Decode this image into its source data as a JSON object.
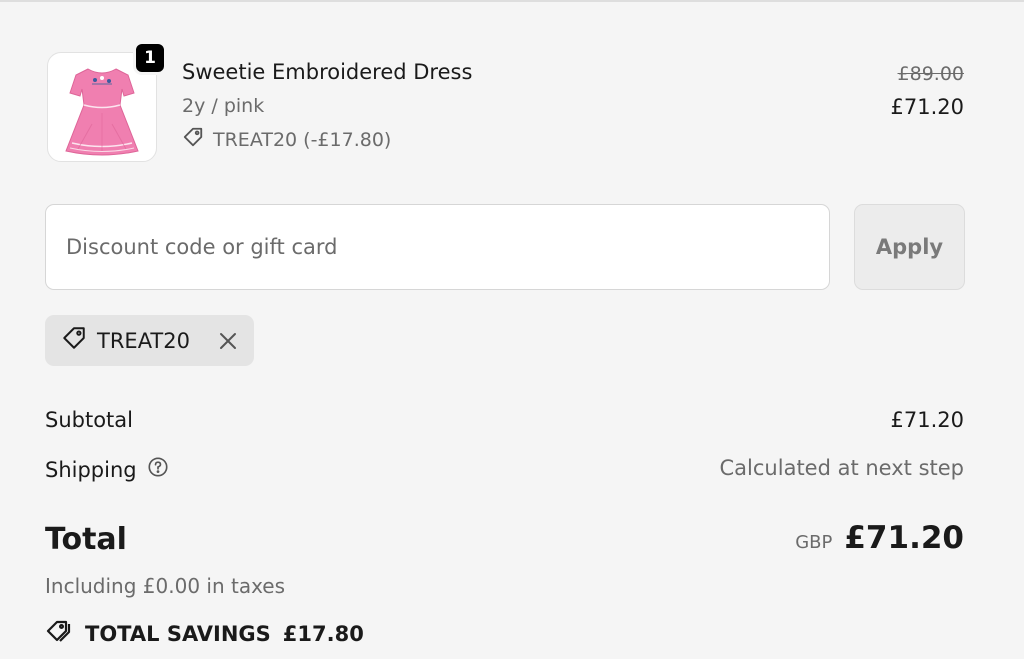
{
  "cart_item": {
    "quantity": "1",
    "name": "Sweetie Embroidered Dress",
    "variant": "2y / pink",
    "discount": "TREAT20 (-£17.80)",
    "original_price": "£89.00",
    "price": "£71.20",
    "image_icon": "pink-dress-image"
  },
  "discount_form": {
    "placeholder": "Discount code or gift card",
    "apply_label": "Apply"
  },
  "applied_code": {
    "label": "TREAT20",
    "icon": "tag-icon",
    "remove_icon": "close-icon"
  },
  "summary": {
    "subtotal_label": "Subtotal",
    "subtotal_value": "£71.20",
    "shipping_label": "Shipping",
    "shipping_value": "Calculated at next step",
    "total_label": "Total",
    "currency": "GBP",
    "total_value": "£71.20",
    "tax_note": "Including £0.00 in taxes",
    "savings_label": "TOTAL SAVINGS",
    "savings_value": "£17.80"
  },
  "colors": {
    "background": "#f5f5f5",
    "text": "#1a1a1a",
    "muted": "#6b6b6b",
    "dress_pink": "#f07fb0"
  }
}
